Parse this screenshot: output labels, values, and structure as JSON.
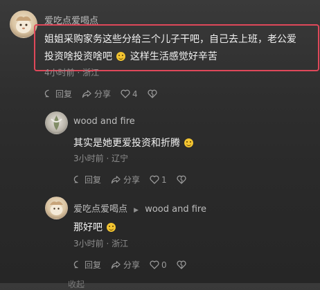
{
  "top_comment": {
    "username": "爱吃点爱喝点",
    "text_line1": "姐姐采购家务这些分给三个儿子干吧，自己去上班，老公爱",
    "text_line2a": "投资啥投资啥吧",
    "text_line2b": "这样生活感觉好辛苦",
    "meta": "4小时前 · 浙江",
    "reply_label": "回复",
    "share_label": "分享",
    "like_count": "4"
  },
  "reply1": {
    "username": "wood and fire",
    "text": "其实是她更爱投资和折腾",
    "meta": "3小时前 · 辽宁",
    "reply_label": "回复",
    "share_label": "分享",
    "like_count": "1"
  },
  "reply2": {
    "username": "爱吃点爱喝点",
    "reply_to": "wood and fire",
    "text": "那好吧",
    "meta": "3小时前 · 浙江",
    "reply_label": "回复",
    "share_label": "分享",
    "like_count": "0"
  },
  "bottom_partial": "收起",
  "colors": {
    "highlight": "#e0485a",
    "emoji": "#f3c531"
  }
}
